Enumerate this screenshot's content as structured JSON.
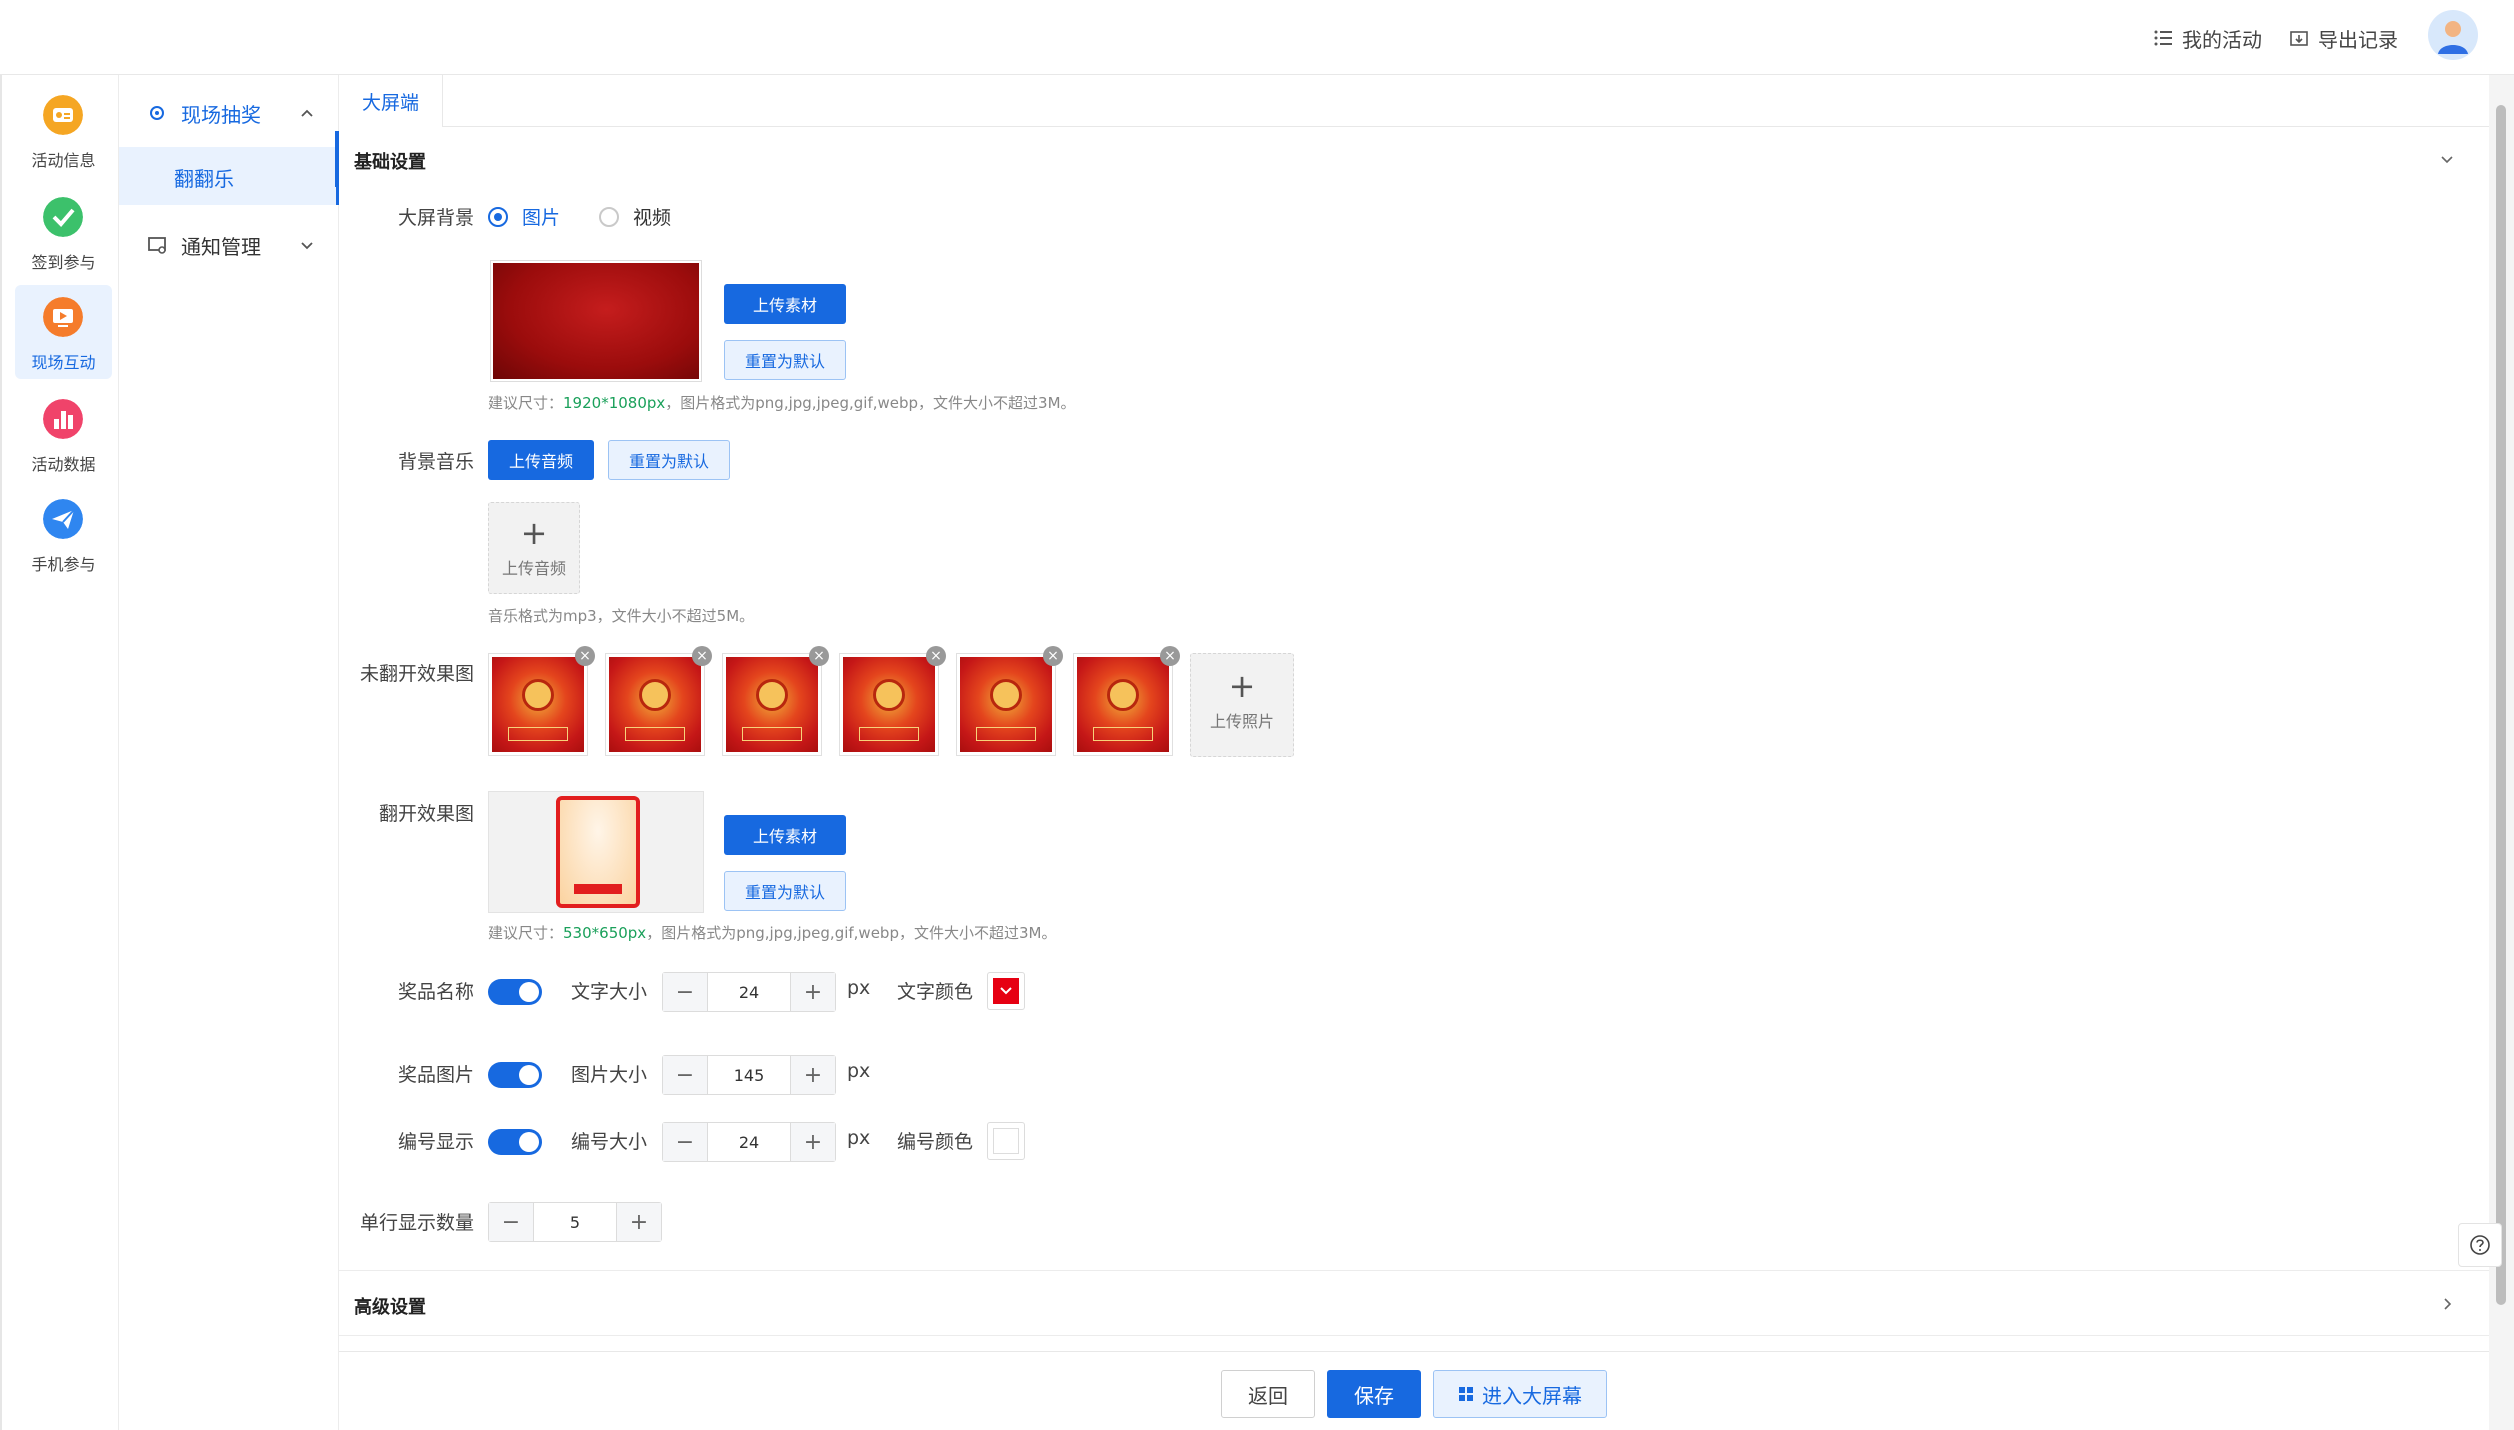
{
  "header": {
    "my_activities": "我的活动",
    "export_records": "导出记录"
  },
  "iconnav": [
    {
      "label": "活动信息",
      "icon": "activity-info-icon"
    },
    {
      "label": "签到参与",
      "icon": "checkin-icon"
    },
    {
      "label": "现场互动",
      "icon": "live-interaction-icon"
    },
    {
      "label": "活动数据",
      "icon": "activity-data-icon"
    },
    {
      "label": "手机参与",
      "icon": "mobile-participate-icon"
    }
  ],
  "subnav": {
    "group1": "现场抽奖",
    "group1_item": "翻翻乐",
    "group2": "通知管理"
  },
  "tab": "大屏端",
  "basic": {
    "title": "基础设置",
    "bg_label": "大屏背景",
    "bg_opt_image": "图片",
    "bg_opt_video": "视频",
    "upload_material": "上传素材",
    "reset_default": "重置为默认",
    "bg_hint_prefix": "建议尺寸：",
    "bg_hint_size": "1920*1080px",
    "bg_hint_suffix": "，图片格式为png,jpg,jpeg,gif,webp，文件大小不超过3M。",
    "music_label": "背景音乐",
    "upload_audio": "上传音频",
    "music_reset": "重置为默认",
    "upload_audio_box": "上传音频",
    "music_hint": "音乐格式为mp3，文件大小不超过5M。",
    "unflipped_label": "未翻开效果图",
    "upload_photo": "上传照片",
    "flipped_label": "翻开效果图",
    "flip_upload": "上传素材",
    "flip_reset": "重置为默认",
    "flip_hint_prefix": "建议尺寸：",
    "flip_hint_size": "530*650px",
    "flip_hint_suffix": "，图片格式为png,jpg,jpeg,gif,webp，文件大小不超过3M。",
    "prize_name_label": "奖品名称",
    "text_size_label": "文字大小",
    "text_size_value": "24",
    "text_color_label": "文字颜色",
    "prize_image_label": "奖品图片",
    "image_size_label": "图片大小",
    "image_size_value": "145",
    "number_display_label": "编号显示",
    "number_size_label": "编号大小",
    "number_size_value": "24",
    "number_color_label": "编号颜色",
    "row_count_label": "单行显示数量",
    "row_count_value": "5",
    "px": "px",
    "minus": "−",
    "plus": "+"
  },
  "advanced": {
    "title": "高级设置"
  },
  "footer": {
    "back": "返回",
    "save": "保存",
    "enter_screen": "进入大屏幕"
  },
  "colors": {
    "primary": "#1769e0",
    "text_color": "#e60012",
    "number_color": "#ffffff"
  }
}
